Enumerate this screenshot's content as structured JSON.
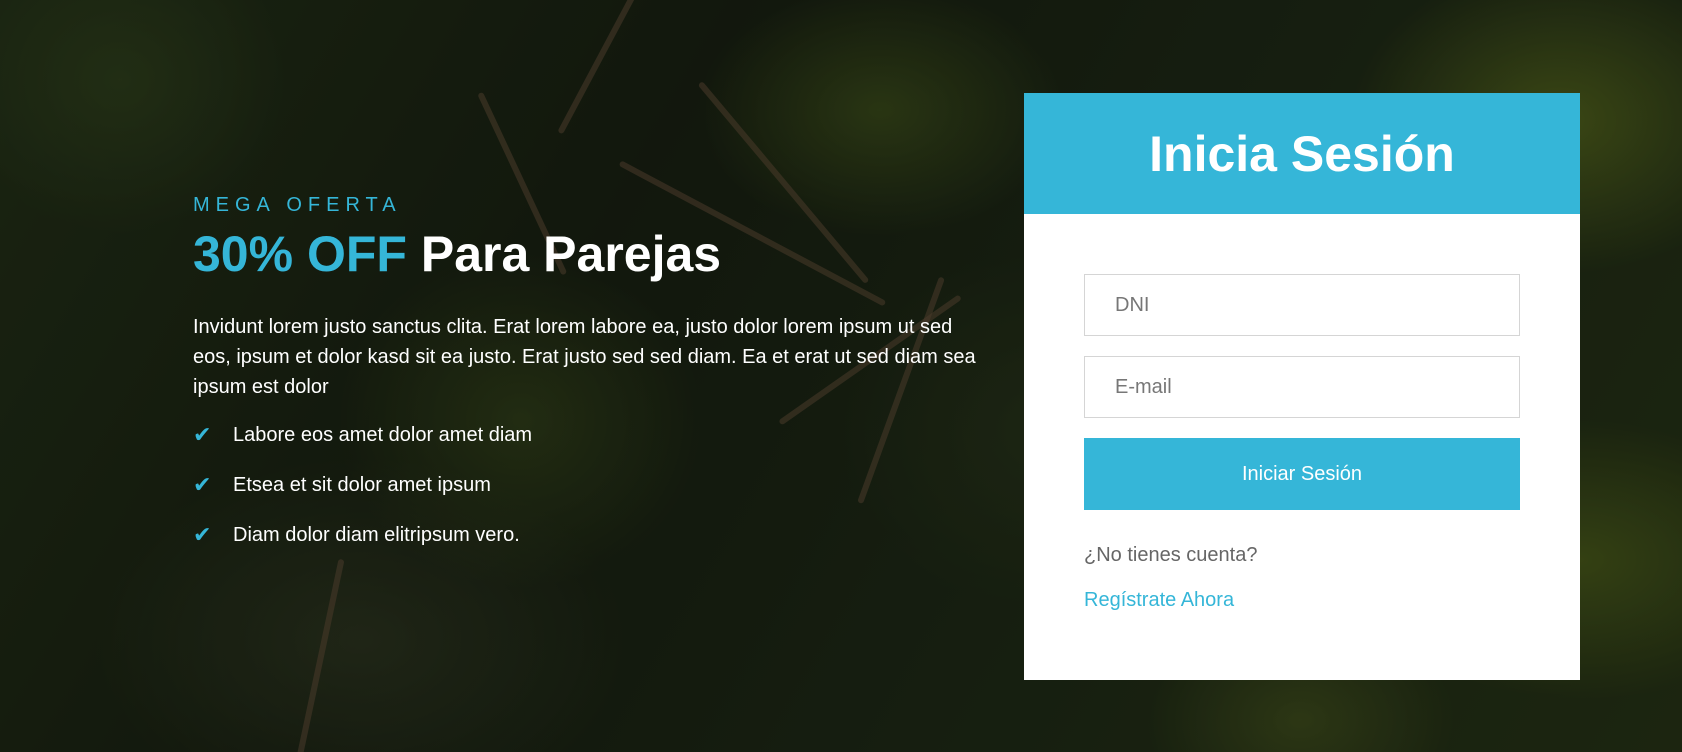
{
  "theme": {
    "accent": "#35b6d8",
    "text_light": "#ffffff",
    "card_background": "#ffffff"
  },
  "hero": {
    "eyebrow": "MEGA OFERTA",
    "headline_accent": "30% OFF",
    "headline_rest": " Para Parejas",
    "description": "Invidunt lorem justo sanctus clita. Erat lorem labore ea, justo dolor lorem ipsum ut sed eos, ipsum et dolor kasd sit ea justo. Erat justo sed sed diam. Ea et erat ut sed diam sea ipsum est dolor",
    "features": [
      {
        "icon": "check-icon",
        "text": "Labore eos amet dolor amet diam"
      },
      {
        "icon": "check-icon",
        "text": "Etsea et sit dolor amet ipsum"
      },
      {
        "icon": "check-icon",
        "text": "Diam dolor diam elitripsum vero."
      }
    ]
  },
  "login": {
    "title": "Inicia Sesión",
    "dni_placeholder": "DNI",
    "dni_value": "",
    "email_placeholder": "E-mail",
    "email_value": "",
    "submit_label": "Iniciar Sesión",
    "no_account_text": "¿No tienes cuenta?",
    "register_link": "Regístrate Ahora"
  }
}
